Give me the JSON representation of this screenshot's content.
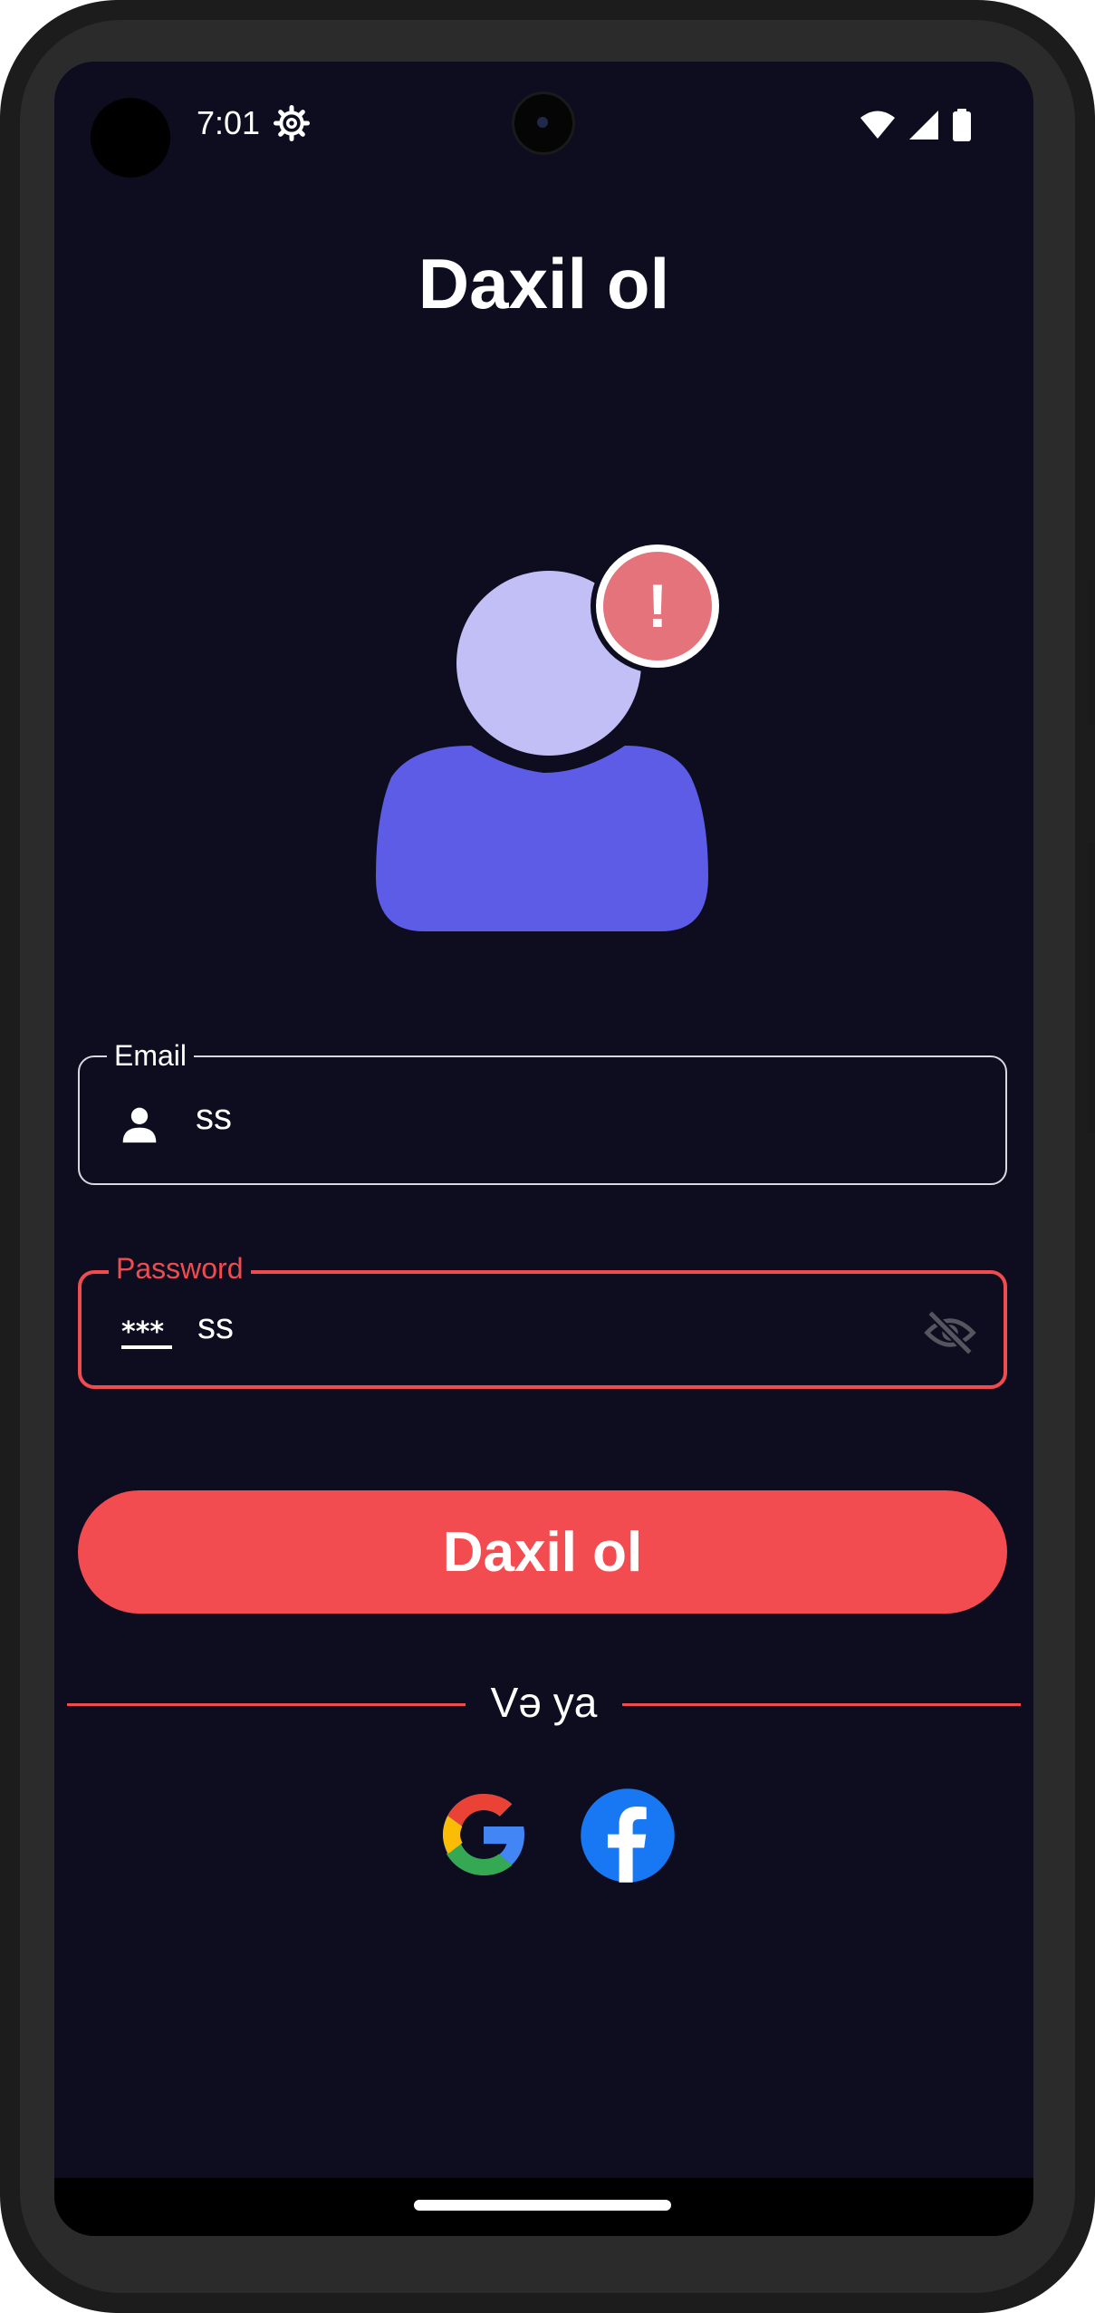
{
  "status_bar": {
    "time": "7:01",
    "icons": [
      "settings-icon",
      "wifi-icon",
      "signal-icon",
      "battery-icon"
    ]
  },
  "title": "Daxil ol",
  "avatar": {
    "icon": "user-error-icon",
    "badge_symbol": "!",
    "colors": {
      "head": "#c1bff5",
      "body": "#5c5ce6",
      "badge": "#e5737c"
    }
  },
  "form": {
    "email": {
      "label": "Email",
      "value": "ss",
      "icon": "person-icon"
    },
    "password": {
      "label": "Password",
      "value": "ss",
      "icon": "password-icon",
      "trailing_icon": "visibility-off-icon",
      "state": "error"
    }
  },
  "login_button": {
    "label": "Daxil ol"
  },
  "divider": {
    "text": "Və ya"
  },
  "social": [
    {
      "name": "Google",
      "icon": "google-icon"
    },
    {
      "name": "Facebook",
      "icon": "facebook-icon"
    }
  ],
  "colors": {
    "background": "#0e0d1f",
    "accent": "#f24b50",
    "text": "#ffffff"
  }
}
